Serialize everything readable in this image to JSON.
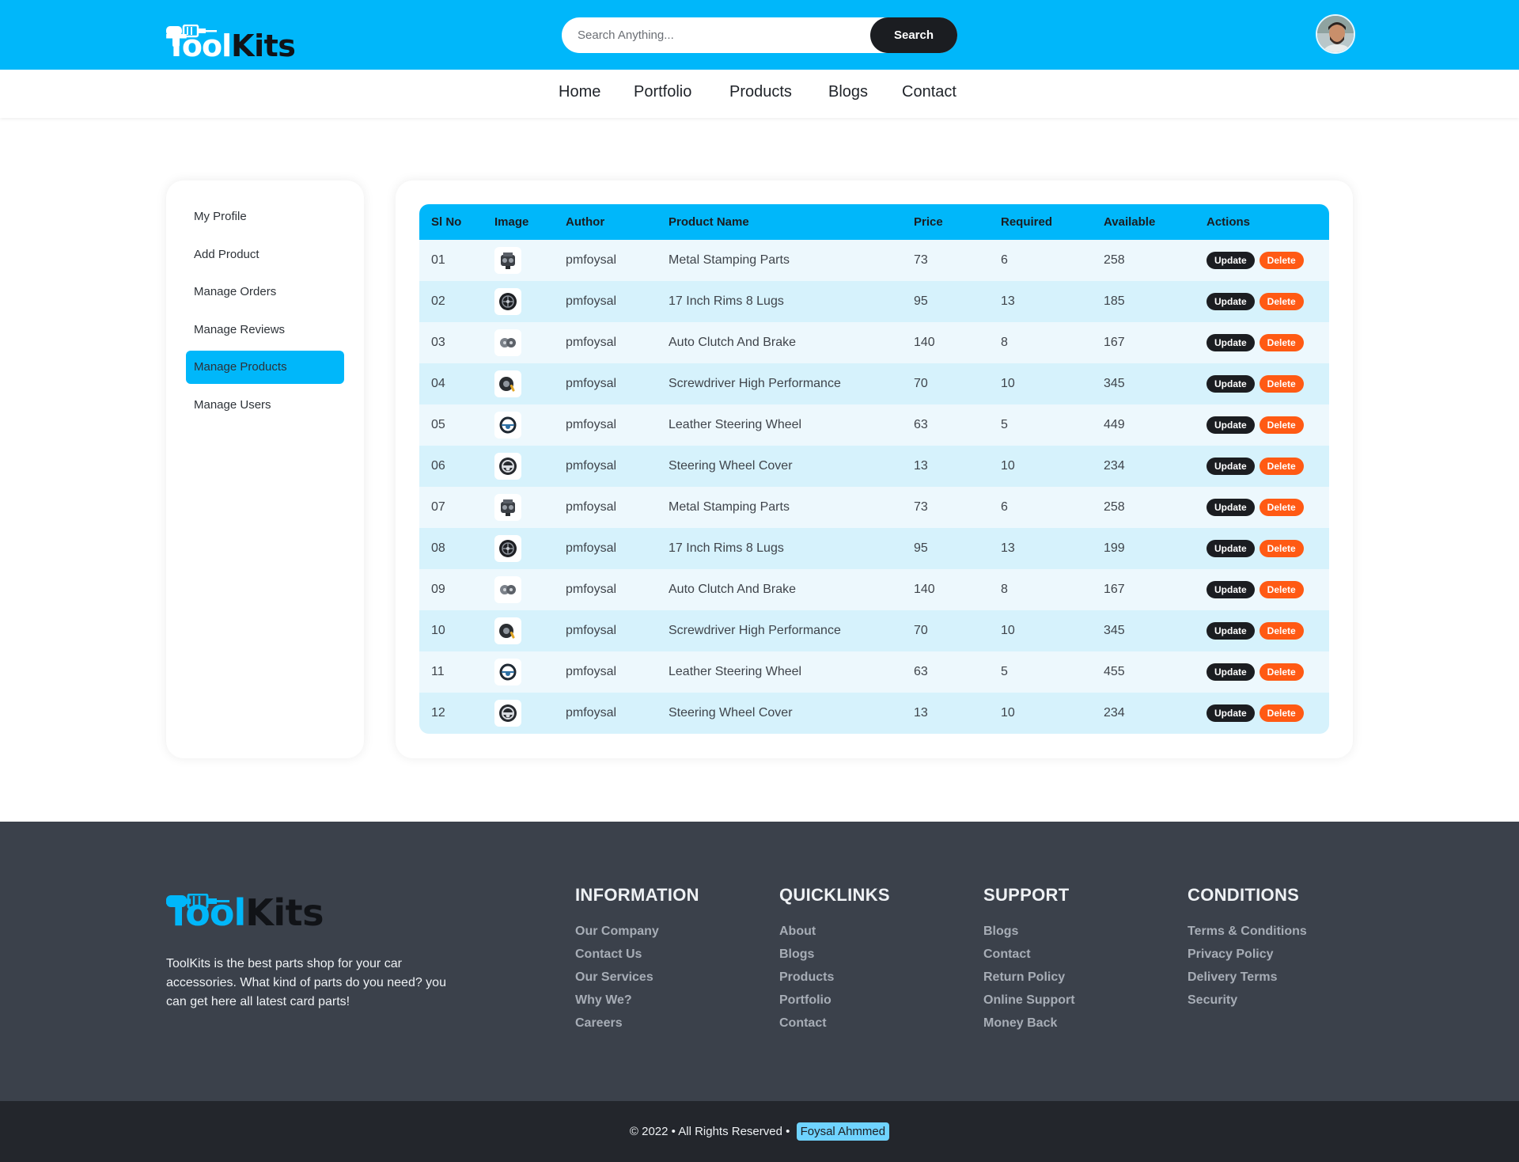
{
  "brand": {
    "part1": "Tool",
    "part2": "Kits"
  },
  "search": {
    "placeholder": "Search Anything...",
    "button_label": "Search"
  },
  "nav": {
    "items": [
      "Home",
      "Portfolio",
      "Products",
      "Blogs",
      "Contact"
    ]
  },
  "sidebar": {
    "items": [
      "My Profile",
      "Add Product",
      "Manage Orders",
      "Manage Reviews",
      "Manage Products",
      "Manage Users"
    ],
    "active": "Manage Products"
  },
  "table": {
    "headers": [
      "Sl No",
      "Image",
      "Author",
      "Product Name",
      "Price",
      "Required",
      "Available",
      "Actions"
    ],
    "update_label": "Update",
    "delete_label": "Delete",
    "rows": [
      {
        "sl": "01",
        "image": "engine-icon",
        "author": "pmfoysal",
        "name": "Metal Stamping Parts",
        "price": "73",
        "required": "6",
        "available": "258"
      },
      {
        "sl": "02",
        "image": "rim-icon",
        "author": "pmfoysal",
        "name": "17 Inch Rims 8 Lugs",
        "price": "95",
        "required": "13",
        "available": "185"
      },
      {
        "sl": "03",
        "image": "clutch-icon",
        "author": "pmfoysal",
        "name": "Auto Clutch And Brake",
        "price": "140",
        "required": "8",
        "available": "167"
      },
      {
        "sl": "04",
        "image": "screwdriver-icon",
        "author": "pmfoysal",
        "name": "Screwdriver High Performance",
        "price": "70",
        "required": "10",
        "available": "345"
      },
      {
        "sl": "05",
        "image": "steering-wheel-icon",
        "author": "pmfoysal",
        "name": "Leather Steering Wheel",
        "price": "63",
        "required": "5",
        "available": "449"
      },
      {
        "sl": "06",
        "image": "wheel-cover-icon",
        "author": "pmfoysal",
        "name": "Steering Wheel Cover",
        "price": "13",
        "required": "10",
        "available": "234"
      },
      {
        "sl": "07",
        "image": "engine-icon",
        "author": "pmfoysal",
        "name": "Metal Stamping Parts",
        "price": "73",
        "required": "6",
        "available": "258"
      },
      {
        "sl": "08",
        "image": "rim-icon",
        "author": "pmfoysal",
        "name": "17 Inch Rims 8 Lugs",
        "price": "95",
        "required": "13",
        "available": "199"
      },
      {
        "sl": "09",
        "image": "clutch-icon",
        "author": "pmfoysal",
        "name": "Auto Clutch And Brake",
        "price": "140",
        "required": "8",
        "available": "167"
      },
      {
        "sl": "10",
        "image": "screwdriver-icon",
        "author": "pmfoysal",
        "name": "Screwdriver High Performance",
        "price": "70",
        "required": "10",
        "available": "345"
      },
      {
        "sl": "11",
        "image": "steering-wheel-icon",
        "author": "pmfoysal",
        "name": "Leather Steering Wheel",
        "price": "63",
        "required": "5",
        "available": "455"
      },
      {
        "sl": "12",
        "image": "wheel-cover-icon",
        "author": "pmfoysal",
        "name": "Steering Wheel Cover",
        "price": "13",
        "required": "10",
        "available": "234"
      }
    ]
  },
  "footer": {
    "description": "ToolKits is the best parts shop for your car accessories. What kind of parts do you need? you can get here all latest card parts!",
    "columns": [
      {
        "title": "INFORMATION",
        "links": [
          "Our Company",
          "Contact Us",
          "Our Services",
          "Why We?",
          "Careers"
        ]
      },
      {
        "title": "QUICKLINKS",
        "links": [
          "About",
          "Blogs",
          "Products",
          "Portfolio",
          "Contact"
        ]
      },
      {
        "title": "SUPPORT",
        "links": [
          "Blogs",
          "Contact",
          "Return Policy",
          "Online Support",
          "Money Back"
        ]
      },
      {
        "title": "CONDITIONS",
        "links": [
          "Terms & Conditions",
          "Privacy Policy",
          "Delivery Terms",
          "Security"
        ]
      }
    ],
    "copyright": "© 2022 • All Rights Reserved •",
    "author": "Foysal Ahmmed"
  },
  "colors": {
    "accent": "#00b7fa",
    "dark": "#1b1d21",
    "danger": "#ff5a14",
    "footer_bg": "#3b414b",
    "bottom_bg": "#23262c"
  }
}
